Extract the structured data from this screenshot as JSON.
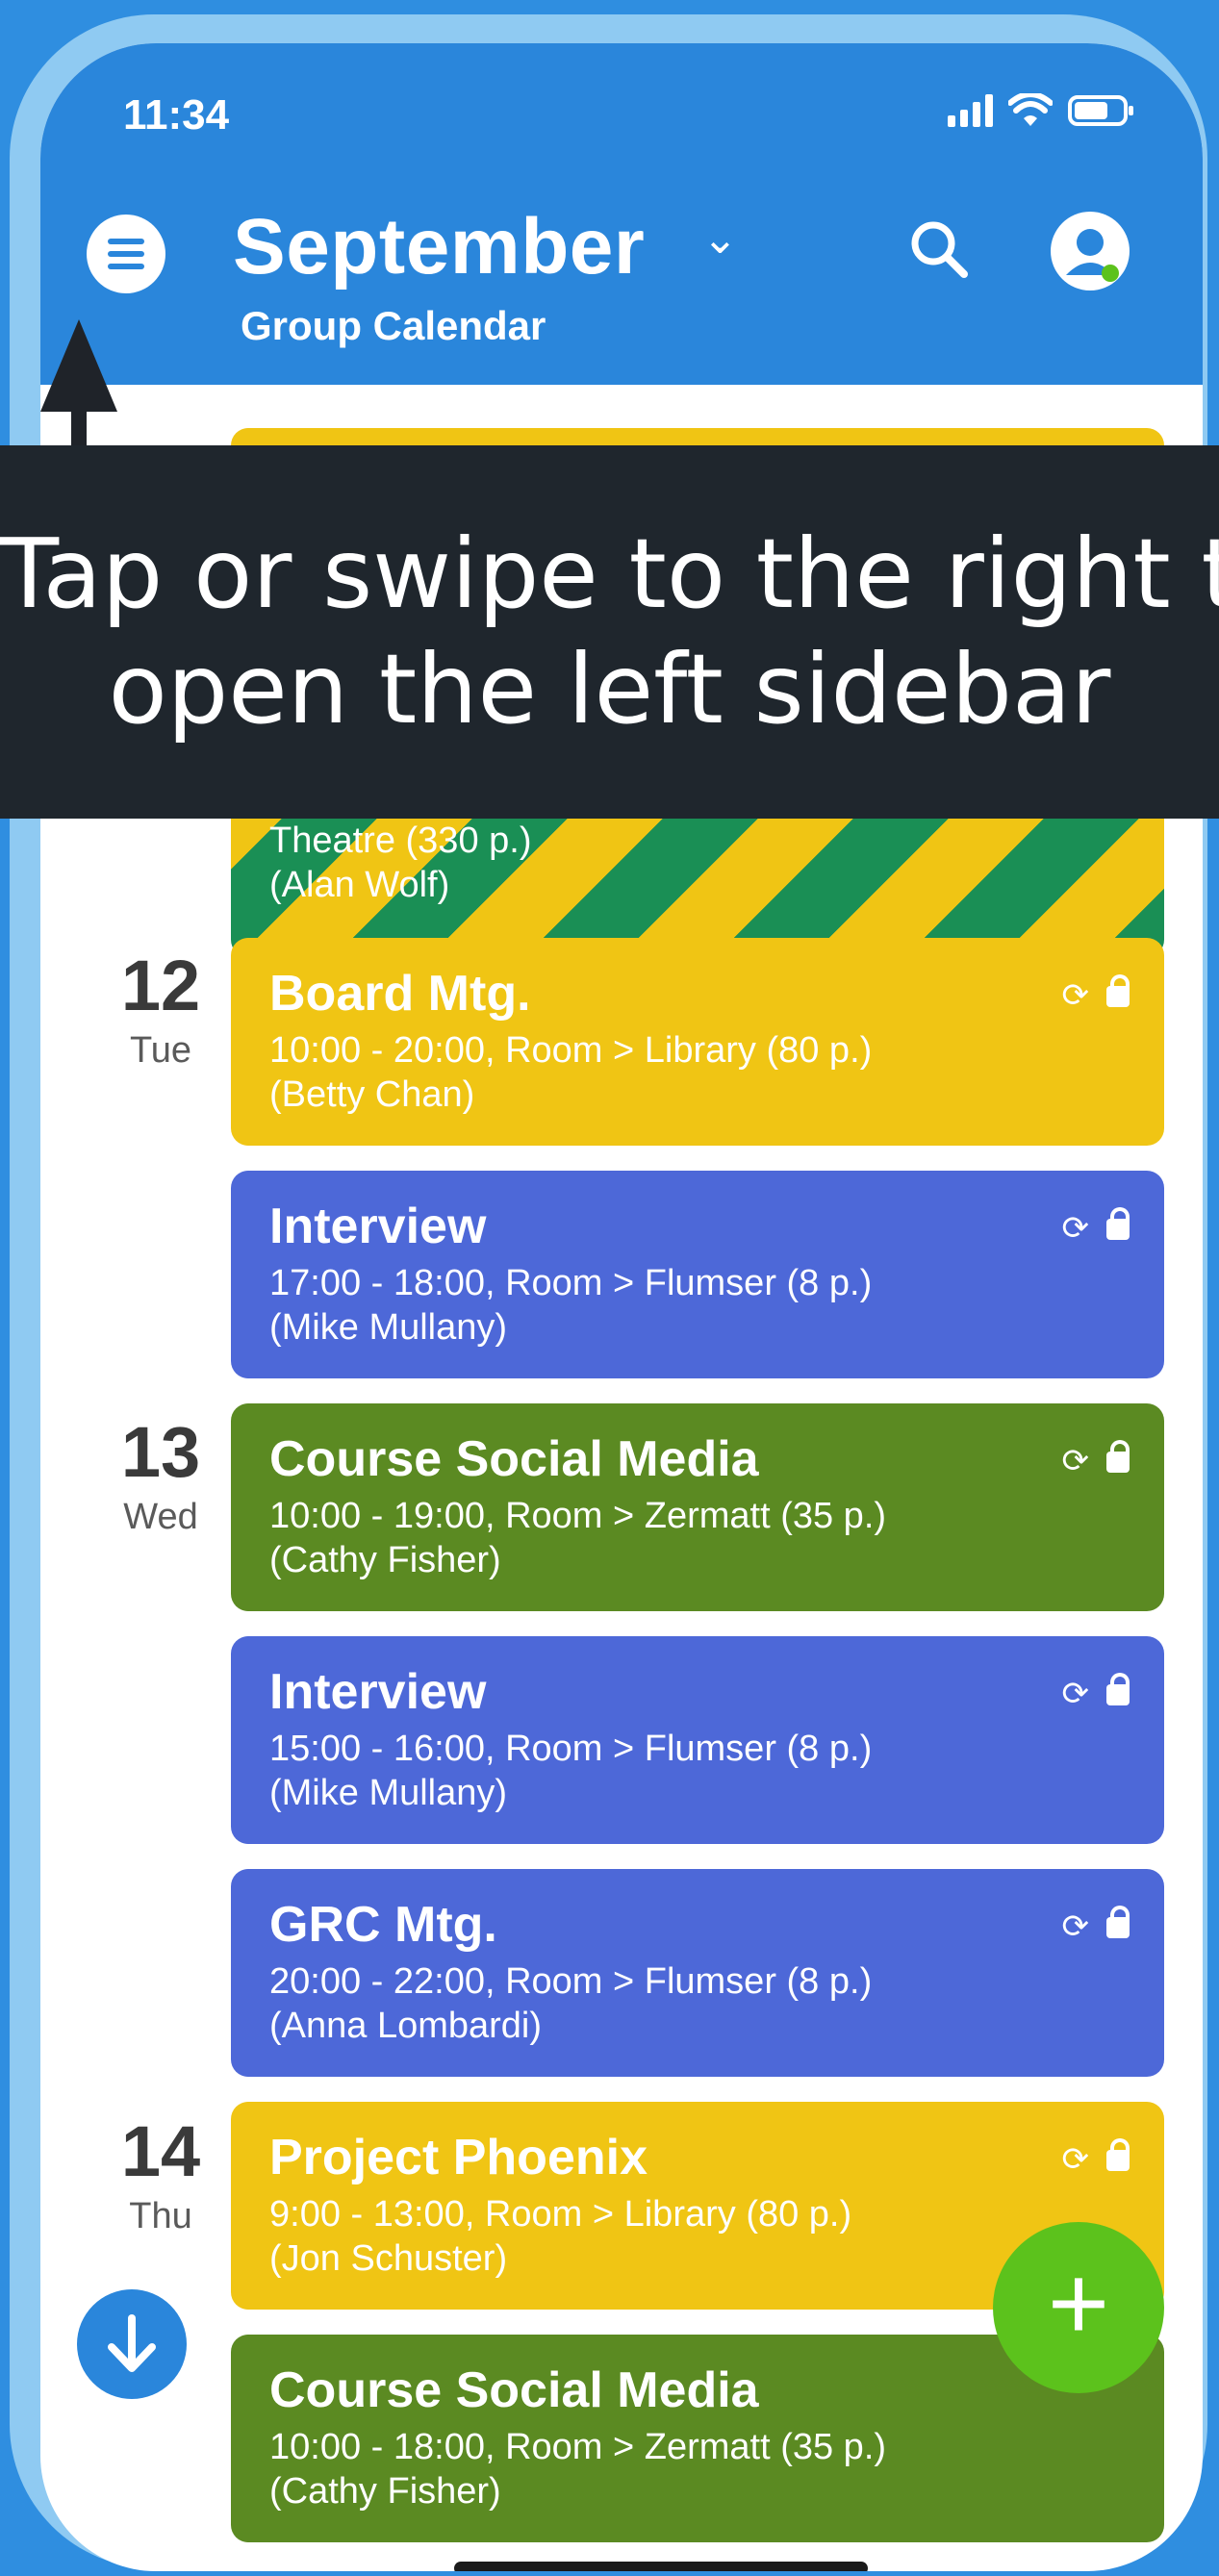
{
  "status": {
    "time": "11:34"
  },
  "header": {
    "title": "September",
    "subtitle": "Group Calendar"
  },
  "banner": {
    "line1": "Tap or swipe to the right to",
    "line2": "open the left sidebar"
  },
  "partial_event": {
    "detail": "Theatre (330 p.)",
    "person": "(Alan Wolf)"
  },
  "days": [
    {
      "num": "12",
      "name": "Tue"
    },
    {
      "num": "13",
      "name": "Wed"
    },
    {
      "num": "14",
      "name": "Thu"
    }
  ],
  "events": [
    {
      "title": "Board Mtg.",
      "detail": "10:00 - 20:00, Room > Library (80 p.)",
      "person": "(Betty Chan)",
      "color": "#f0c514"
    },
    {
      "title": "Interview",
      "detail": "17:00 - 18:00, Room > Flumser (8 p.)",
      "person": "(Mike Mullany)",
      "color": "#4d68d8"
    },
    {
      "title": "Course Social Media",
      "detail": "10:00 - 19:00, Room > Zermatt (35 p.)",
      "person": "(Cathy Fisher)",
      "color": "#5b8a22"
    },
    {
      "title": "Interview",
      "detail": "15:00 - 16:00, Room > Flumser (8 p.)",
      "person": "(Mike Mullany)",
      "color": "#4d68d8"
    },
    {
      "title": "GRC Mtg.",
      "detail": "20:00 - 22:00, Room > Flumser (8 p.)",
      "person": "(Anna Lombardi)",
      "color": "#4d68d8"
    },
    {
      "title": "Project Phoenix",
      "detail": "9:00 - 13:00, Room > Library (80 p.)",
      "person": "(Jon Schuster)",
      "color": "#f0c514"
    },
    {
      "title": "Course Social Media",
      "detail": "10:00 - 18:00, Room > Zermatt (35 p.)",
      "person": "(Cathy Fisher)",
      "color": "#5b8a22"
    }
  ],
  "icons": {
    "menu": "menu-icon",
    "search": "search-icon",
    "profile": "profile-icon",
    "recurring": "recurring-icon",
    "lock": "lock-icon",
    "down": "arrow-down-icon",
    "add": "plus-icon"
  },
  "fab": {
    "add": "+"
  }
}
